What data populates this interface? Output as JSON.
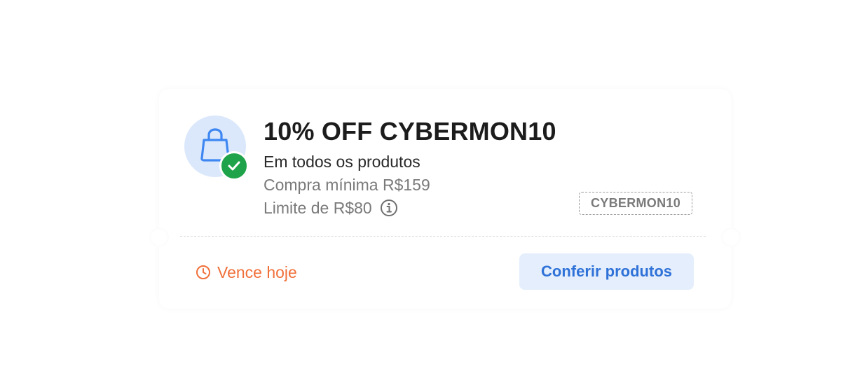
{
  "coupon": {
    "title": "10% OFF CYBERMON10",
    "subtitle": "Em todos os produtos",
    "min_purchase": "Compra mínima R$159",
    "limit": "Limite de R$80",
    "code": "CYBERMON10",
    "expiry": "Vence hoje",
    "cta_label": "Conferir produtos",
    "icons": {
      "product": "shopping-bag-icon",
      "status": "check-icon",
      "info": "info-icon",
      "expiry": "clock-icon"
    },
    "colors": {
      "accent_blue": "#2f72d8",
      "icon_bg": "#dbe8fb",
      "success_green": "#1fa34a",
      "expiry_orange": "#f0703a",
      "button_bg": "#e4eefc"
    }
  }
}
